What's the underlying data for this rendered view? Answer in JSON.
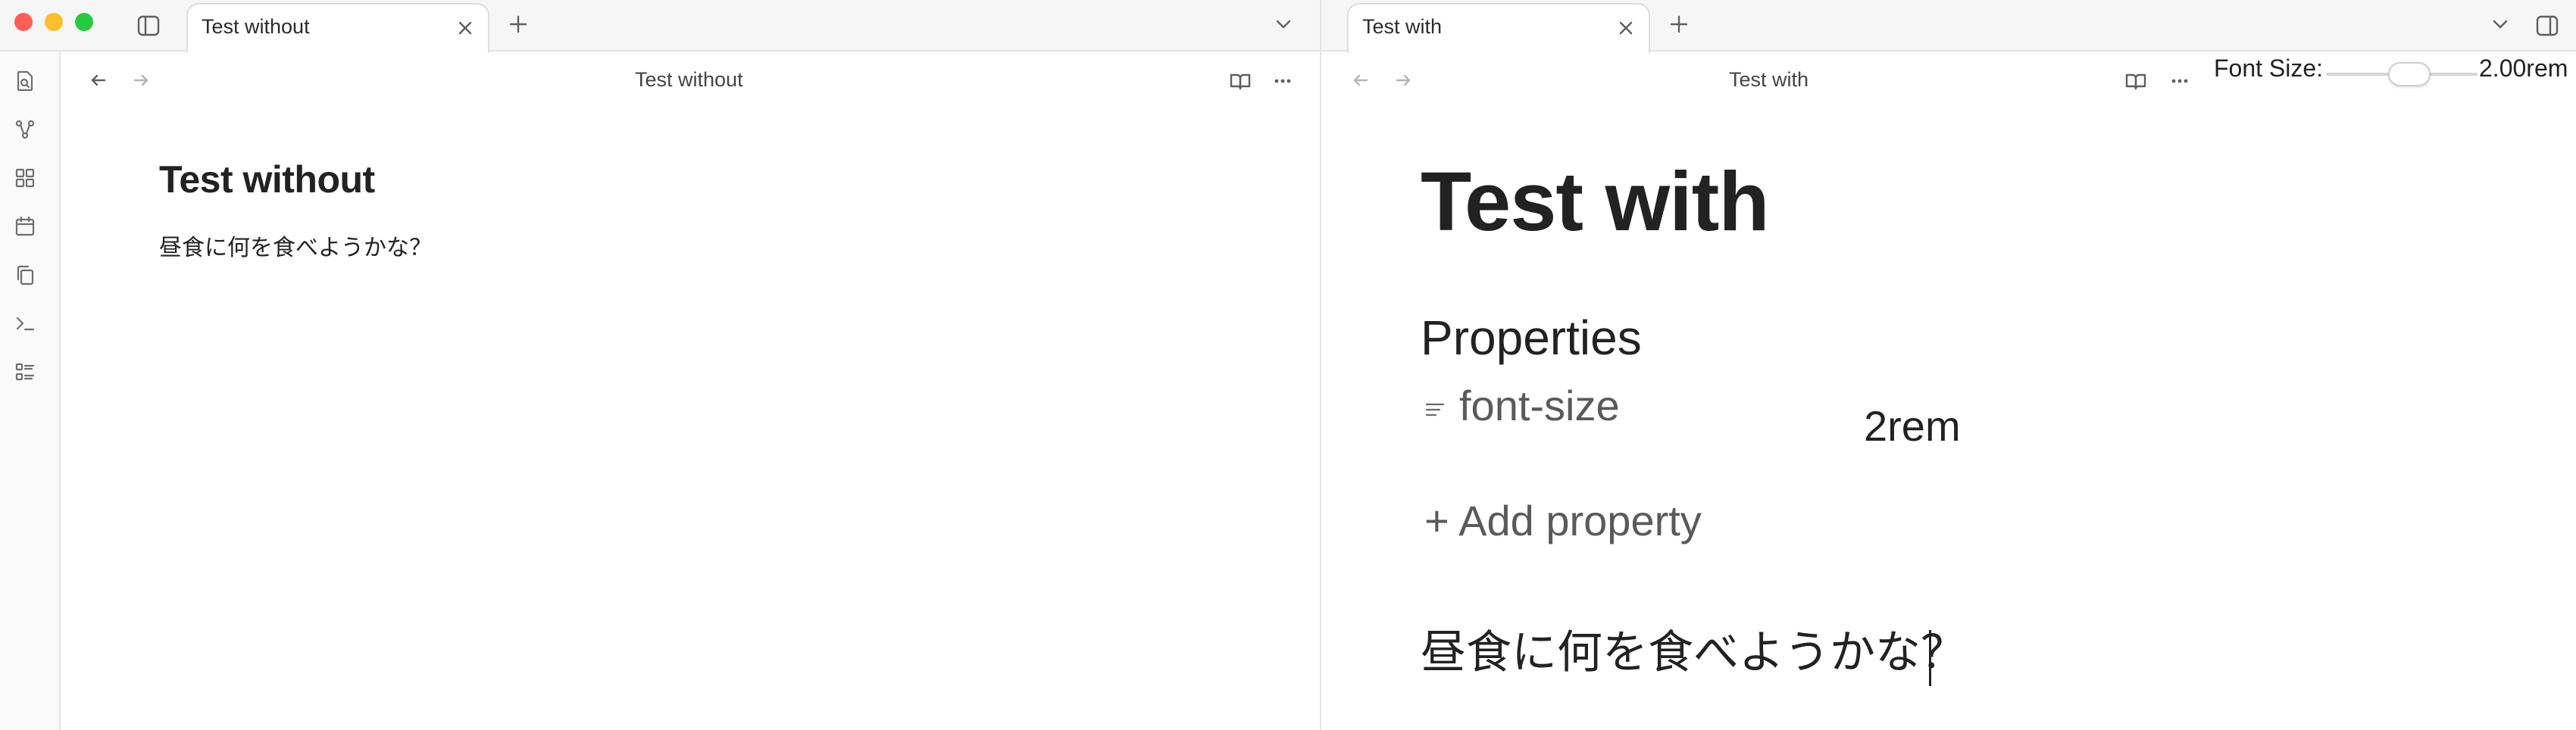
{
  "window": {
    "traffic_lights": {
      "close": "#ff5f57",
      "minimize": "#febc2e",
      "maximize": "#28c840"
    }
  },
  "left_pane": {
    "tab": {
      "label": "Test without"
    },
    "view_title": "Test without",
    "note": {
      "title": "Test without",
      "body": "昼食に何を食べようかな？"
    }
  },
  "right_pane": {
    "tab": {
      "label": "Test with"
    },
    "view_title": "Test with",
    "font_size_control": {
      "label": "Font Size:",
      "value": "2.00rem",
      "slider_fraction": 0.5
    },
    "note": {
      "title": "Test with",
      "properties_heading": "Properties",
      "properties": [
        {
          "key": "font-size",
          "value": "2rem"
        }
      ],
      "add_property_label": "+ Add property",
      "body": "昼食に何を食べようかな？"
    }
  },
  "ribbon": {
    "icons": [
      "search-file-icon",
      "graph-icon",
      "canvas-icon",
      "calendar-icon",
      "copy-icon",
      "terminal-icon",
      "list-icon"
    ]
  }
}
